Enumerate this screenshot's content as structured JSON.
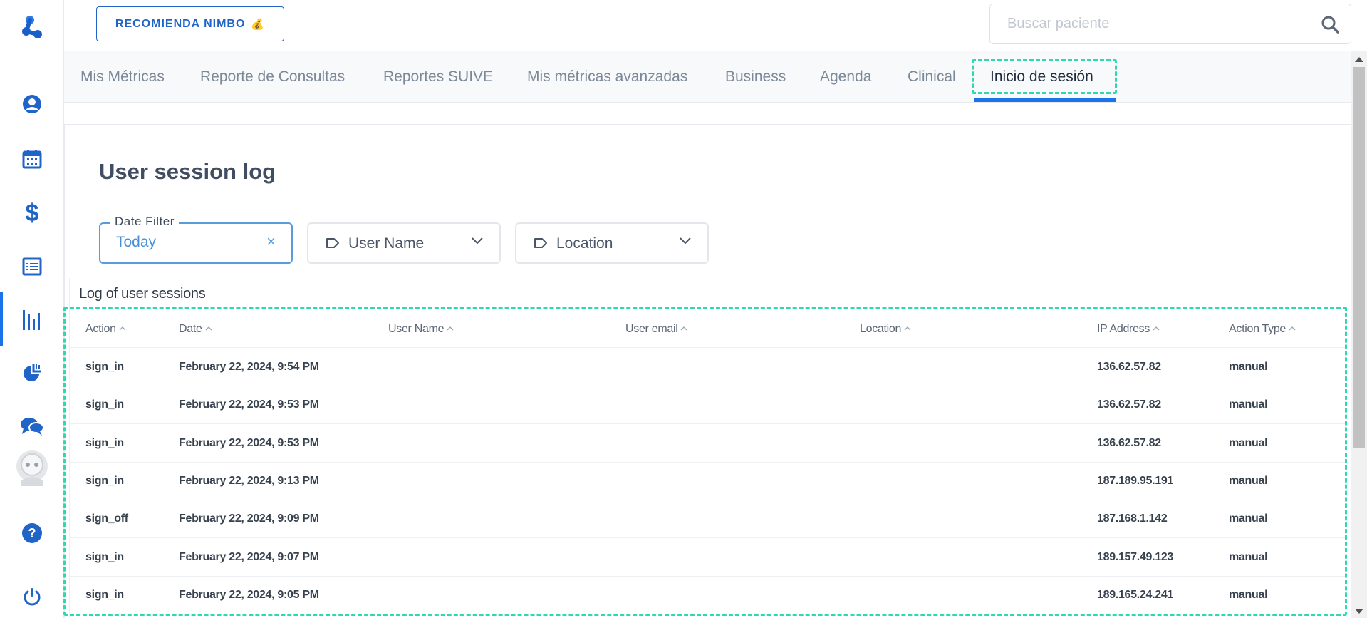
{
  "header": {
    "recommend_label": "RECOMIENDA NIMBO",
    "recommend_icon": "money-bag-icon",
    "search_placeholder": "Buscar paciente"
  },
  "sidebar": {
    "icons": [
      "logo-icon",
      "user-icon",
      "calendar-icon",
      "dollar-icon",
      "list-icon",
      "metrics-icon",
      "analytics-icon",
      "chat-icon",
      "avatar-icon",
      "help-icon",
      "power-icon"
    ],
    "active": "metrics-icon"
  },
  "tabs": [
    {
      "label": "Mis Métricas"
    },
    {
      "label": "Reporte de Consultas"
    },
    {
      "label": "Reportes SUIVE"
    },
    {
      "label": "Mis métricas avanzadas"
    },
    {
      "label": "Business"
    },
    {
      "label": "Agenda"
    },
    {
      "label": "Clinical"
    },
    {
      "label": "Inicio de sesión"
    }
  ],
  "active_tab": "Inicio de sesión",
  "page": {
    "title": "User session log",
    "date_filter": {
      "legend": "Date Filter",
      "value": "Today"
    },
    "user_filter": {
      "label": "User Name"
    },
    "location_filter": {
      "label": "Location"
    },
    "log_title": "Log of user sessions"
  },
  "table": {
    "columns": [
      "Action",
      "Date",
      "User Name",
      "User email",
      "Location",
      "IP Address",
      "Action Type"
    ],
    "rows": [
      {
        "action": "sign_in",
        "date": "February 22, 2024, 9:54 PM",
        "user_name": "",
        "user_email": "",
        "location": "",
        "ip": "136.62.57.82",
        "type": "manual"
      },
      {
        "action": "sign_in",
        "date": "February 22, 2024, 9:53 PM",
        "user_name": "",
        "user_email": "",
        "location": "",
        "ip": "136.62.57.82",
        "type": "manual"
      },
      {
        "action": "sign_in",
        "date": "February 22, 2024, 9:53 PM",
        "user_name": "",
        "user_email": "",
        "location": "",
        "ip": "136.62.57.82",
        "type": "manual"
      },
      {
        "action": "sign_in",
        "date": "February 22, 2024, 9:13 PM",
        "user_name": "",
        "user_email": "",
        "location": "",
        "ip": "187.189.95.191",
        "type": "manual"
      },
      {
        "action": "sign_off",
        "date": "February 22, 2024, 9:09 PM",
        "user_name": "",
        "user_email": "",
        "location": "",
        "ip": "187.168.1.142",
        "type": "manual"
      },
      {
        "action": "sign_in",
        "date": "February 22, 2024, 9:07 PM",
        "user_name": "",
        "user_email": "",
        "location": "",
        "ip": "189.157.49.123",
        "type": "manual"
      },
      {
        "action": "sign_in",
        "date": "February 22, 2024, 9:05 PM",
        "user_name": "",
        "user_email": "",
        "location": "",
        "ip": "189.165.24.241",
        "type": "manual"
      }
    ]
  },
  "colors": {
    "accent": "#1a73e8",
    "highlight": "#2fd9b0",
    "icon": "#1f64c6"
  }
}
